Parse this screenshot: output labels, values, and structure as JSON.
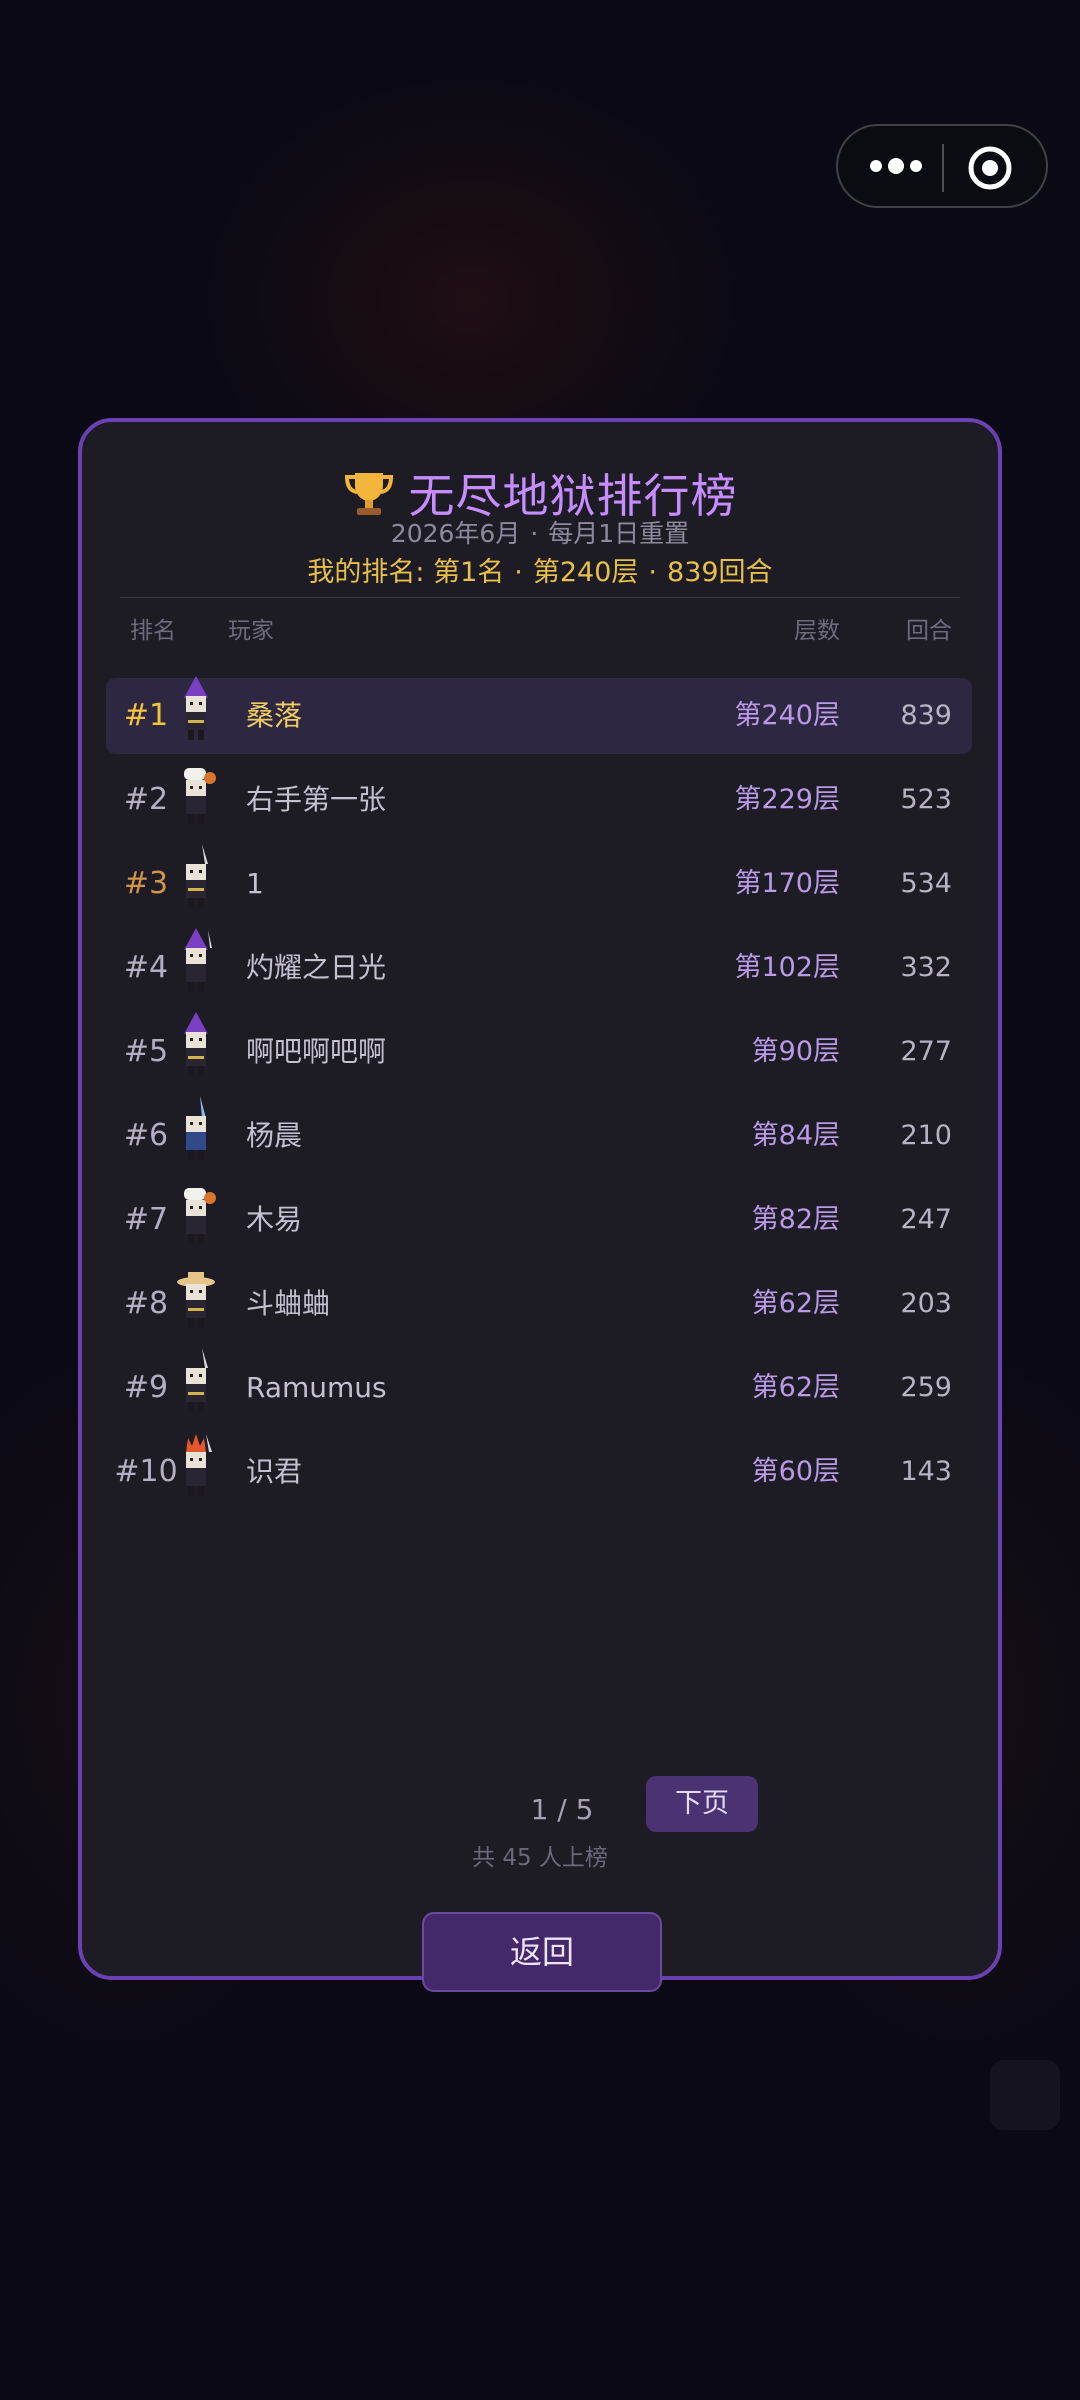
{
  "capsule": {
    "more_icon": "more-dots-icon",
    "close_icon": "target-circle-icon"
  },
  "panel": {
    "title_icon": "trophy-icon",
    "title": "无尽地狱排行榜",
    "subtitle_month": "2026年6月",
    "subtitle_sep": "·",
    "subtitle_reset": "每月1日重置",
    "my_rank": {
      "label": "我的排名: 第1名",
      "sep": "·",
      "floor": "第240层",
      "turns": "839回合"
    },
    "columns": {
      "rank": "排名",
      "player": "玩家",
      "floor": "层数",
      "turns": "回合"
    },
    "rows": [
      {
        "rank": "#1",
        "name": "桑落",
        "floor": "第240层",
        "turns": "839"
      },
      {
        "rank": "#2",
        "name": "右手第一张",
        "floor": "第229层",
        "turns": "523"
      },
      {
        "rank": "#3",
        "name": "1",
        "floor": "第170层",
        "turns": "534"
      },
      {
        "rank": "#4",
        "name": "灼耀之日光",
        "floor": "第102层",
        "turns": "332"
      },
      {
        "rank": "#5",
        "name": "啊吧啊吧啊",
        "floor": "第90层",
        "turns": "277"
      },
      {
        "rank": "#6",
        "name": "杨晨",
        "floor": "第84层",
        "turns": "210"
      },
      {
        "rank": "#7",
        "name": "木易",
        "floor": "第82层",
        "turns": "247"
      },
      {
        "rank": "#8",
        "name": "斗蛐蛐",
        "floor": "第62层",
        "turns": "203"
      },
      {
        "rank": "#9",
        "name": "Ramumus",
        "floor": "第62层",
        "turns": "259"
      },
      {
        "rank": "#10",
        "name": "识君",
        "floor": "第60层",
        "turns": "143"
      }
    ],
    "pager": {
      "page": "1 / 5",
      "next": "下页",
      "total": "共 45 人上榜"
    },
    "back": "返回"
  },
  "colors": {
    "accent_purple": "#c78cff",
    "gold": "#f2c43e",
    "bronze": "#d09548",
    "panel_border": "#6b40b2",
    "button_bg": "#4b3272"
  }
}
